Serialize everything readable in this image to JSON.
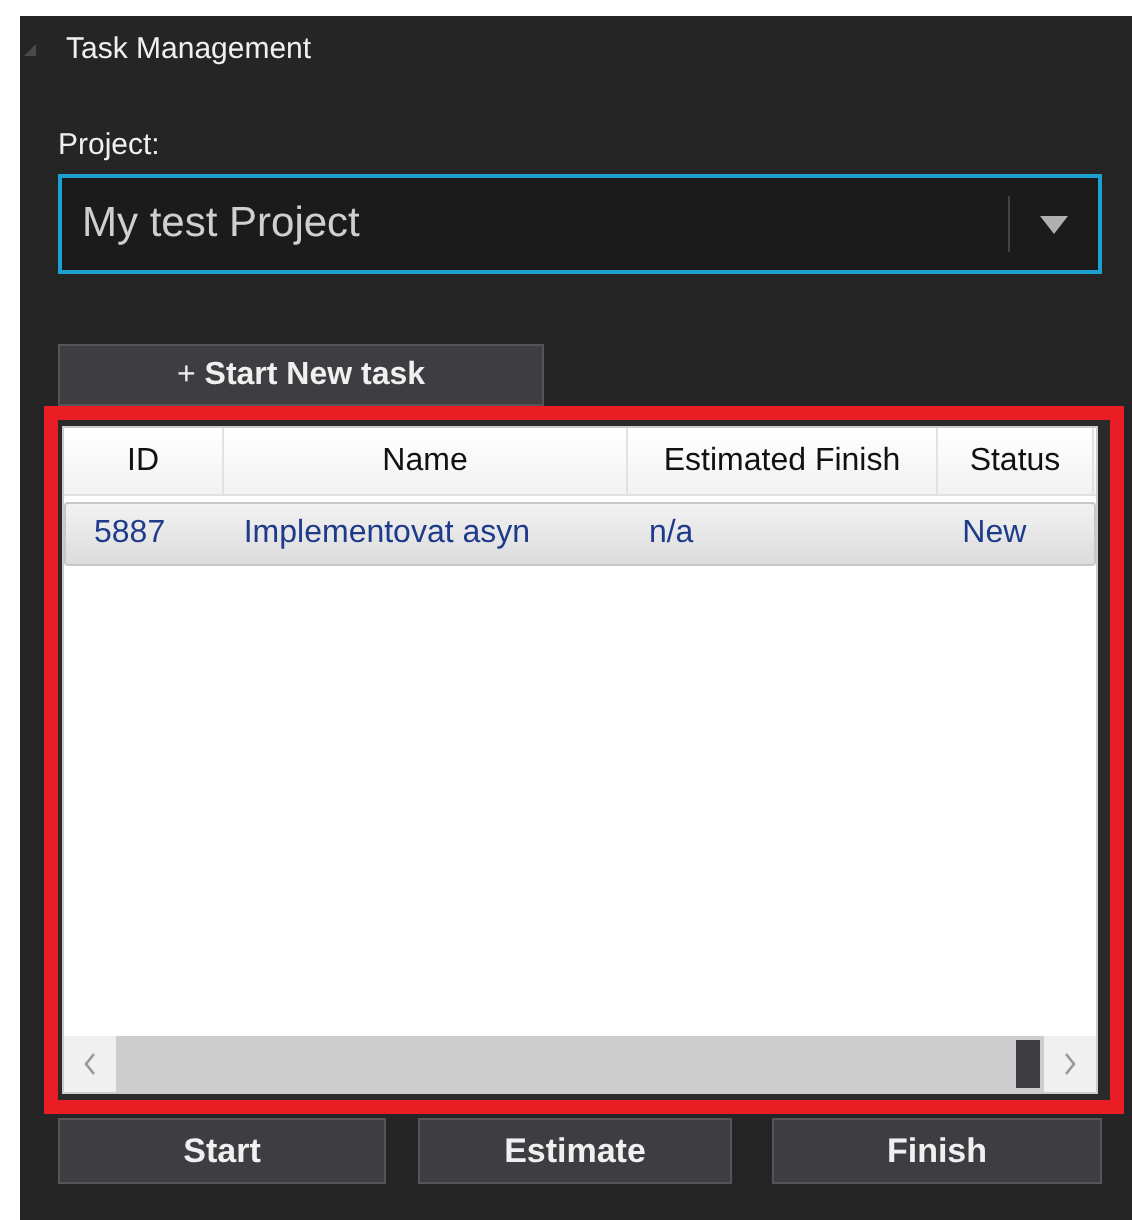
{
  "panel": {
    "title": "Task Management"
  },
  "project": {
    "label": "Project:",
    "value": "My test Project"
  },
  "new_task_button": "+ **Start New task**",
  "table": {
    "columns": [
      "ID",
      "Name",
      "Estimated Finish",
      "Status"
    ],
    "rows": [
      {
        "cells": [
          "5887",
          "Implementovat asyn",
          "n/a",
          "New"
        ],
        "selected": true
      }
    ]
  },
  "buttons": [
    "Start",
    "Estimate",
    "Finish"
  ]
}
